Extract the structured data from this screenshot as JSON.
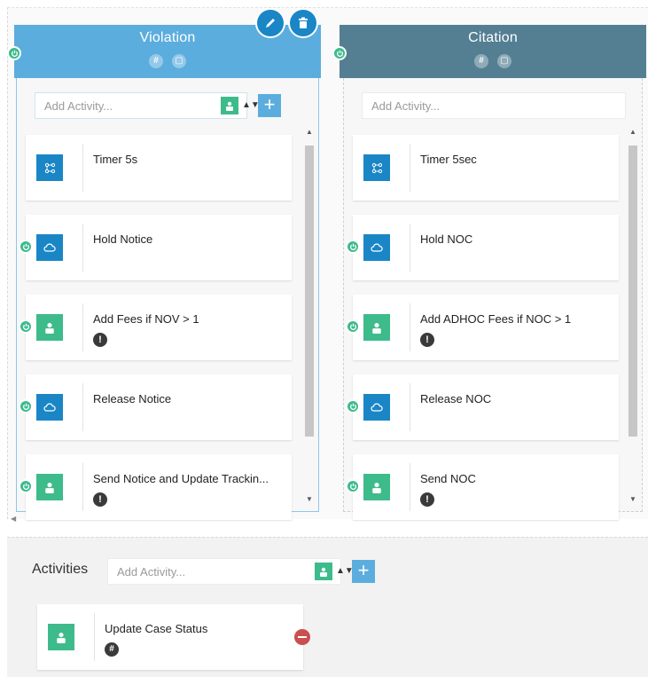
{
  "colors": {
    "violation_header": "#5badde",
    "citation_header": "#547f93",
    "icon_blue": "#1a86c6",
    "icon_green": "#3dbb8b",
    "remove_red": "#c9504f"
  },
  "stage_actions": {
    "edit_icon": "pencil-icon",
    "delete_icon": "trash-icon"
  },
  "stages": [
    {
      "title": "Violation",
      "hash_glyph": "#",
      "square_glyph": "▢",
      "add_placeholder": "Add Activity...",
      "plus_label": "+",
      "sort_glyph": "▲▼",
      "activities": [
        {
          "label": "Timer 5s",
          "icon": "timer-icon",
          "color": "blue",
          "power": false,
          "alert": ""
        },
        {
          "label": "Hold Notice",
          "icon": "cloud-icon",
          "color": "blue",
          "power": true,
          "alert": ""
        },
        {
          "label": "Add Fees if NOV > 1",
          "icon": "user-icon",
          "color": "green",
          "power": true,
          "alert": "!"
        },
        {
          "label": "Release Notice",
          "icon": "cloud-icon",
          "color": "blue",
          "power": true,
          "alert": ""
        },
        {
          "label": "Send Notice and Update Trackin...",
          "icon": "user-icon",
          "color": "green",
          "power": true,
          "alert": "!"
        }
      ]
    },
    {
      "title": "Citation",
      "hash_glyph": "#",
      "square_glyph": "▢",
      "add_placeholder": "Add Activity...",
      "activities": [
        {
          "label": "Timer 5sec",
          "icon": "timer-icon",
          "color": "blue",
          "power": false,
          "alert": ""
        },
        {
          "label": "Hold NOC",
          "icon": "cloud-icon",
          "color": "blue",
          "power": true,
          "alert": ""
        },
        {
          "label": "Add ADHOC Fees if NOC > 1",
          "icon": "user-icon",
          "color": "green",
          "power": true,
          "alert": "!"
        },
        {
          "label": "Release NOC",
          "icon": "cloud-icon",
          "color": "blue",
          "power": true,
          "alert": ""
        },
        {
          "label": "Send NOC",
          "icon": "user-icon",
          "color": "green",
          "power": true,
          "alert": "!"
        }
      ]
    }
  ],
  "activities_panel": {
    "title": "Activities",
    "add_placeholder": "Add Activity...",
    "plus_label": "+",
    "sort_glyph": "▲▼",
    "items": [
      {
        "label": "Update Case Status",
        "icon": "user-icon",
        "badge": "#"
      }
    ]
  }
}
